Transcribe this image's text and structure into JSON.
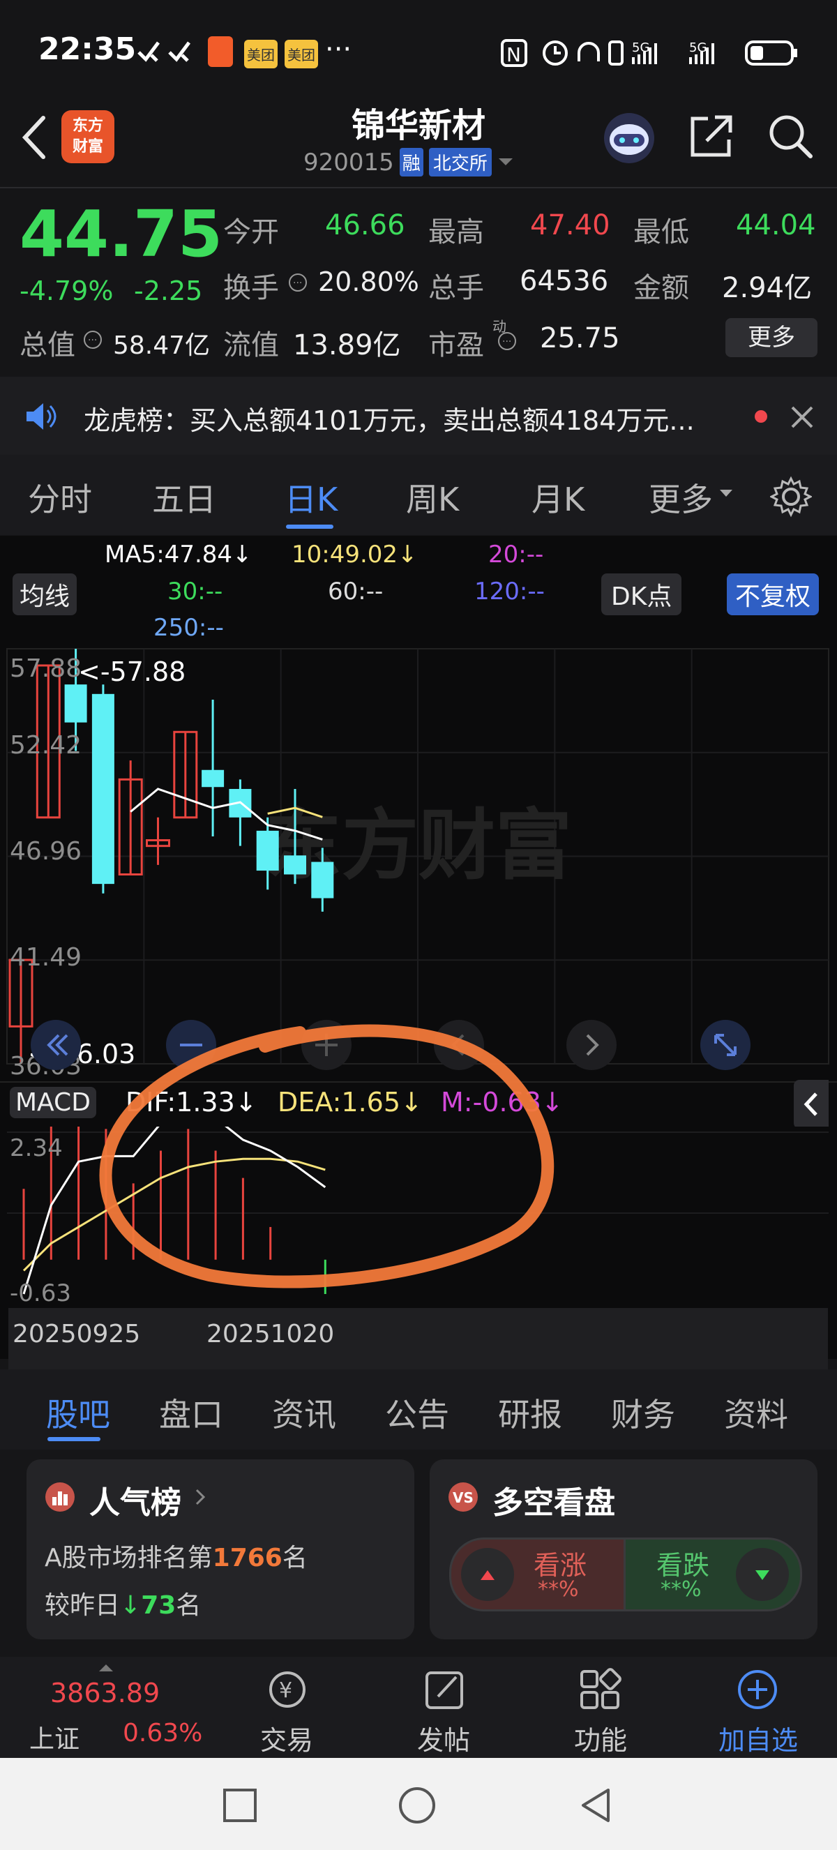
{
  "status": {
    "time": "22:35",
    "dots": "···",
    "badge_meituan": "美团",
    "badge_5g1": "5G",
    "badge_5g2": "5G"
  },
  "header": {
    "logo_text": "东方\n财富",
    "title": "锦华新材",
    "code": "920015",
    "tag_rong": "融",
    "tag_exchange": "北交所"
  },
  "quote": {
    "price": "44.75",
    "change_pct": "-4.79%",
    "change": "-2.25",
    "open_label": "今开",
    "open": "46.66",
    "high_label": "最高",
    "high": "47.40",
    "low_label": "最低",
    "low": "44.04",
    "turnover_label": "换手",
    "turnover": "20.80%",
    "volume_label": "总手",
    "volume": "64536",
    "amount_label": "金额",
    "amount": "2.94亿",
    "total_value_label": "总值",
    "total_value": "58.47亿",
    "float_value_label": "流值",
    "float_value": "13.89亿",
    "pe_label": "市盈",
    "pe_sup": "动",
    "pe": "25.75",
    "more_btn": "更多"
  },
  "notice": {
    "text": "龙虎榜：买入总额4101万元，卖出总额4184万元..."
  },
  "chart_tabs": [
    "分时",
    "五日",
    "日K",
    "周K",
    "月K",
    "更多"
  ],
  "indicators": {
    "ma_btn": "均线",
    "ma5": "MA5:47.84↓",
    "ma10": "10:49.02↓",
    "ma20": "20:--",
    "ma30": "30:--",
    "ma60": "60:--",
    "ma120": "120:--",
    "ma250": "250:--",
    "dk_btn": "DK点",
    "fq_btn": "不复权"
  },
  "kline_axis": {
    "y_labels": [
      "57.88",
      "52.42",
      "46.96",
      "41.49",
      "36.03"
    ],
    "max_label": "<-57.88",
    "min_label": "<-36.03",
    "watermark": "东方财富"
  },
  "macd": {
    "btn": "MACD",
    "dif": "DIF:1.33↓",
    "dea": "DEA:1.65↓",
    "m": "M:-0.63↓",
    "y_top": "2.34",
    "y_bottom": "-0.63",
    "x_labels": [
      "20250925",
      "20251020"
    ]
  },
  "chart_data": {
    "type": "candlestick",
    "candles": [
      {
        "open": 38.0,
        "close": 41.5,
        "high": 41.5,
        "low": 36.03
      },
      {
        "open": 49.0,
        "close": 57.0,
        "high": 57.0,
        "low": 49.0
      },
      {
        "open": 56.0,
        "close": 54.0,
        "high": 57.88,
        "low": 52.5
      },
      {
        "open": 55.5,
        "close": 45.5,
        "high": 56.0,
        "low": 45.0
      },
      {
        "open": 46.0,
        "close": 51.0,
        "high": 52.0,
        "low": 46.0
      },
      {
        "open": 47.5,
        "close": 47.8,
        "high": 49.0,
        "low": 46.5
      },
      {
        "open": 49.0,
        "close": 53.5,
        "high": 53.5,
        "low": 49.0
      },
      {
        "open": 51.5,
        "close": 50.6,
        "high": 55.2,
        "low": 48.0
      },
      {
        "open": 50.5,
        "close": 49.0,
        "high": 51.0,
        "low": 47.5
      },
      {
        "open": 48.3,
        "close": 46.2,
        "high": 49.0,
        "low": 45.2
      },
      {
        "open": 47.0,
        "close": 46.0,
        "high": 50.5,
        "low": 45.5
      },
      {
        "open": 46.66,
        "close": 44.75,
        "high": 47.4,
        "low": 44.04
      }
    ],
    "ylim": [
      36.03,
      57.88
    ],
    "ma5": [
      null,
      null,
      null,
      null,
      49.3,
      50.5,
      50.0,
      49.5,
      49.8,
      48.6,
      48.3,
      47.84
    ],
    "ma10": [
      null,
      null,
      null,
      null,
      null,
      null,
      null,
      null,
      null,
      49.2,
      49.5,
      49.02
    ],
    "macd_dif": [
      -0.63,
      1.0,
      1.8,
      1.9,
      1.9,
      2.5,
      2.7,
      2.6,
      2.2,
      2.0,
      1.7,
      1.33
    ],
    "macd_dea": [
      -0.2,
      0.3,
      0.6,
      0.9,
      1.2,
      1.5,
      1.7,
      1.8,
      1.85,
      1.85,
      1.8,
      1.65
    ],
    "macd_hist": [
      1.3,
      2.9,
      2.9,
      2.4,
      1.4,
      2.0,
      2.4,
      2.0,
      1.5,
      0.6,
      0.0,
      -0.63
    ],
    "macd_ylim": [
      -0.63,
      2.34
    ]
  },
  "content_tabs": [
    "股吧",
    "盘口",
    "资讯",
    "公告",
    "研报",
    "财务",
    "资料"
  ],
  "cards": {
    "popular_title": "人气榜",
    "popular_line1_prefix": "A股市场排名第",
    "popular_rank": "1766",
    "popular_line1_suffix": "名",
    "popular_line2_prefix": "较昨日",
    "popular_delta": "73",
    "popular_line2_suffix": "名",
    "vs_title": "多空看盘",
    "bull_label": "看涨",
    "bull_value": "**%",
    "bear_label": "看跌",
    "bear_value": "**%"
  },
  "bottom_nav": {
    "index_value": "3863.89",
    "index_name": "上证",
    "index_pct": "0.63%",
    "trade": "交易",
    "post": "发帖",
    "func": "功能",
    "add": "加自选"
  }
}
